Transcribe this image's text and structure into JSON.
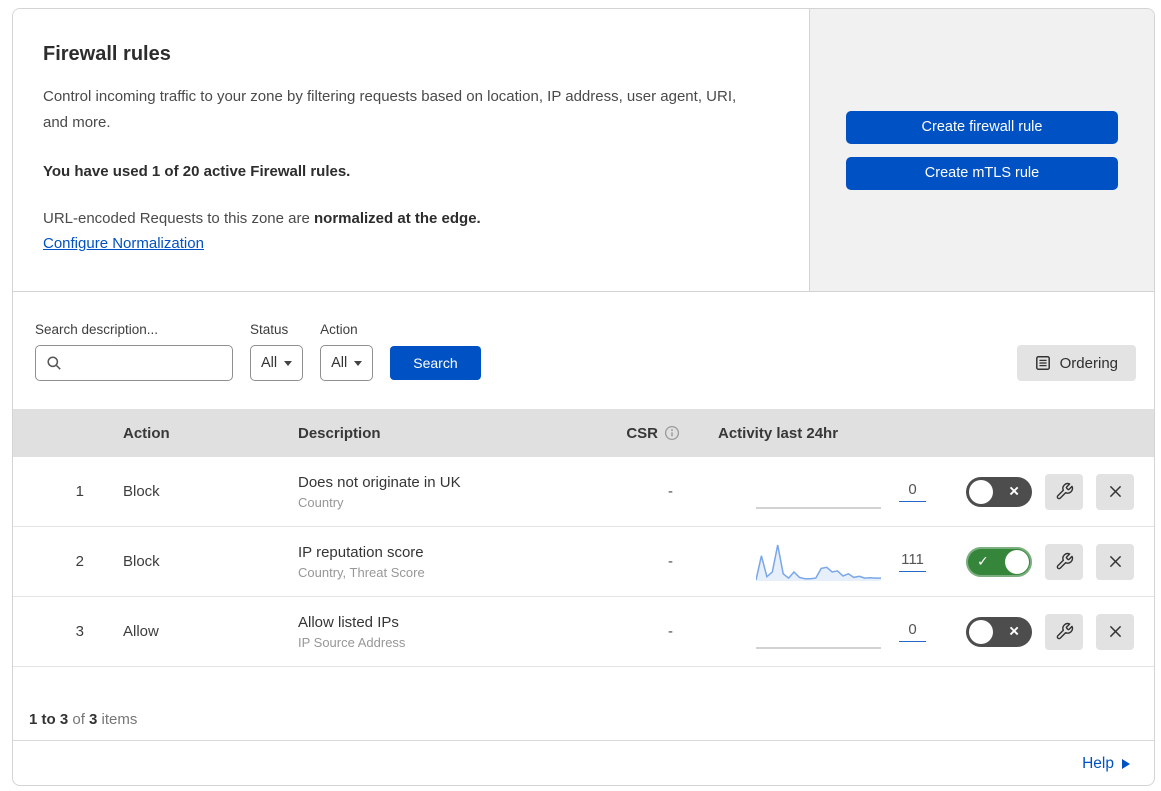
{
  "intro": {
    "title": "Firewall rules",
    "description": "Control incoming traffic to your zone by filtering requests based on location, IP address, user agent, URI, and more.",
    "usage_note": "You have used 1 of 20 active Firewall rules.",
    "normalization_text": "URL-encoded Requests to this zone are ",
    "normalization_bold": "normalized at the edge.",
    "normalization_link": "Configure Normalization"
  },
  "actions_panel": {
    "create_firewall_rule_label": "Create firewall rule",
    "create_mtls_rule_label": "Create mTLS rule"
  },
  "filters": {
    "search_label": "Search description...",
    "search_value": "",
    "status_label": "Status",
    "status_value": "All",
    "action_label": "Action",
    "action_value": "All",
    "search_button_label": "Search",
    "ordering_button_label": "Ordering"
  },
  "table": {
    "headers": {
      "action": "Action",
      "description": "Description",
      "csr": "CSR",
      "activity": "Activity last 24hr"
    },
    "rows": [
      {
        "priority": "1",
        "action": "Block",
        "description": "Does not originate in UK",
        "fields": "Country",
        "csr": "-",
        "activity_count": "0",
        "enabled": false,
        "sparkline": []
      },
      {
        "priority": "2",
        "action": "Block",
        "description": "IP reputation score",
        "fields": "Country, Threat Score",
        "csr": "-",
        "activity_count": "111",
        "enabled": true,
        "sparkline": [
          3,
          70,
          12,
          25,
          100,
          20,
          8,
          25,
          10,
          6,
          6,
          8,
          35,
          38,
          25,
          28,
          14,
          20,
          10,
          13,
          8,
          9,
          8,
          8
        ]
      },
      {
        "priority": "3",
        "action": "Allow",
        "description": "Allow listed IPs",
        "fields": "IP Source Address",
        "csr": "-",
        "activity_count": "0",
        "enabled": false,
        "sparkline": []
      }
    ]
  },
  "footer": {
    "range": "1 to 3",
    "of_text": " of ",
    "total": "3",
    "items_text": " items"
  },
  "help": {
    "label": "Help"
  },
  "colors": {
    "accent_blue": "#0051c3",
    "toggle_on_green": "#35853b",
    "toggle_off_gray": "#4d4d4d",
    "sparkline_blue": "#79a7e8",
    "panel_gray": "#f1f1f1",
    "table_header_gray": "#e0e0e0"
  }
}
